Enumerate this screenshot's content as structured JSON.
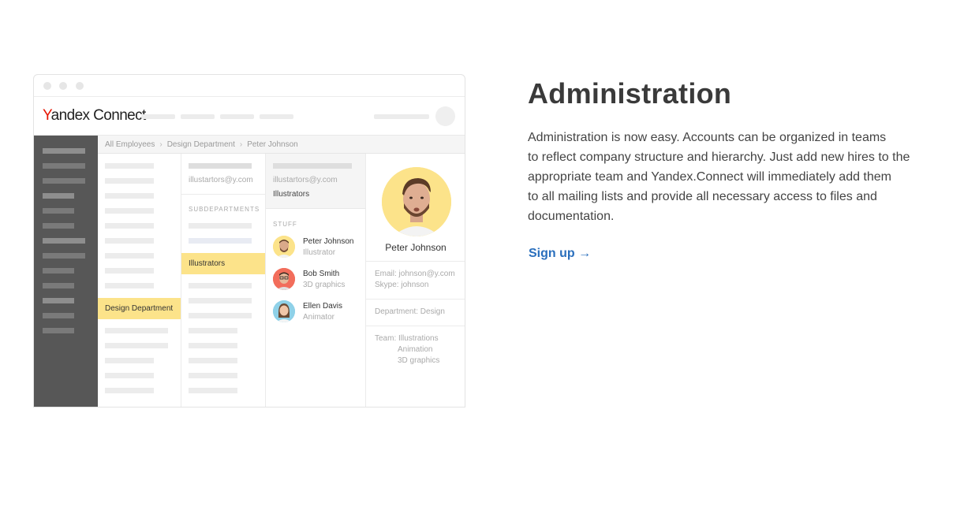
{
  "app": {
    "logo_y": "Y",
    "logo_andex": "andex",
    "logo_connect": "Connect"
  },
  "breadcrumbs": [
    "All Employees",
    "Design Department",
    "Peter Johnson"
  ],
  "columns": {
    "col1_selected": "Design Department",
    "col2_email": "illustartors@y.com",
    "col2_section": "SUBDEPARTMENTS",
    "col2_selected": "Illustrators",
    "col3_email": "illustartors@y.com",
    "col3_team": "Illustrators",
    "col3_section": "STUFF"
  },
  "staff": [
    {
      "name": "Peter Johnson",
      "role": "Illustrator",
      "color": "#fce38a"
    },
    {
      "name": "Bob Smith",
      "role": "3D graphics",
      "color": "#f26d5b"
    },
    {
      "name": "Ellen Davis",
      "role": "Animator",
      "color": "#8fd1e8"
    }
  ],
  "profile": {
    "name": "Peter Johnson",
    "email": "Email: johnson@y.com",
    "skype": "Skype: johnson",
    "department": "Department: Design",
    "team_label": "Team: Illustrations",
    "team_extra": [
      "Animation",
      "3D graphics"
    ],
    "avatar_color": "#fce38a"
  },
  "section": {
    "heading": "Administration",
    "description_lines": [
      "Administration is now easy. Accounts can be organized in teams",
      "to reflect company structure and hierarchy. Just add new hires to the",
      "appropriate team and Yandex.Connect will immediately add them",
      "to all mailing lists and provide all necessary access to files and",
      "documentation."
    ],
    "cta": "Sign up →"
  },
  "colors": {
    "accent": "#2a6fbd",
    "highlight": "#fce38a",
    "sidebar": "#575757",
    "logo_red": "#e61400"
  }
}
